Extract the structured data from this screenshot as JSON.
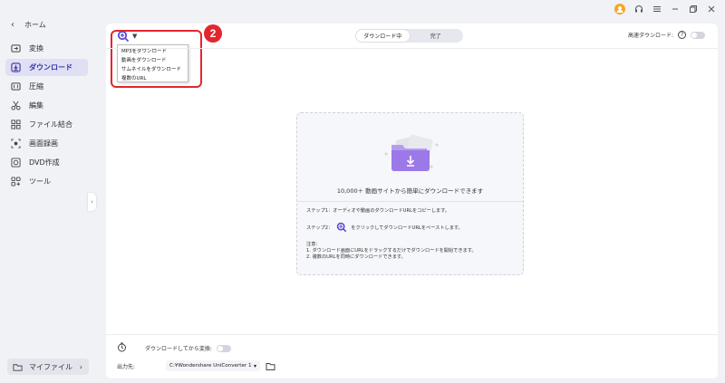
{
  "sidebar": {
    "home_label": "ホーム",
    "items": [
      {
        "label": "変換",
        "icon": "convert-icon"
      },
      {
        "label": "ダウンロード",
        "icon": "download-icon",
        "active": true
      },
      {
        "label": "圧縮",
        "icon": "compress-icon"
      },
      {
        "label": "編集",
        "icon": "edit-icon"
      },
      {
        "label": "ファイル結合",
        "icon": "merge-icon"
      },
      {
        "label": "画面録画",
        "icon": "screen-record-icon"
      },
      {
        "label": "DVD作成",
        "icon": "dvd-icon"
      },
      {
        "label": "ツール",
        "icon": "toolbox-icon"
      }
    ],
    "myfiles_label": "マイファイル"
  },
  "toolbar": {
    "dropdown_options": [
      "MP3をダウンロード",
      "動画をダウンロード",
      "サムネイルをダウンロード",
      "複数のURL"
    ],
    "tabs": [
      {
        "label": "ダウンロード中",
        "active": true
      },
      {
        "label": "完了",
        "active": false
      }
    ],
    "high_speed_label": "高速ダウンロード:",
    "step_badge": "2"
  },
  "dropzone": {
    "title": "10,000＋ 動画サイトから簡単にダウンロードできます",
    "step1": "ステップ1：オーディオや動画のダウンロードURLをコピーします。",
    "step2_prefix": "ステップ2：",
    "step2_suffix": "をクリックしてダウンロードURLをペーストします。",
    "note_title": "注意：",
    "note1": "1. ダウンロード画面にURLをドラッグするだけでダウンロードを開始できます。",
    "note2": "2. 複数のURLを同時にダウンロードできます。"
  },
  "bottom": {
    "convert_after_label": "ダウンロードしてから変換:",
    "output_label": "出力先:",
    "output_path": "C:¥Wondershare UniConverter 1"
  },
  "colors": {
    "accent": "#3a2fa8",
    "highlight": "#e3262d",
    "avatar": "#f5a623"
  }
}
